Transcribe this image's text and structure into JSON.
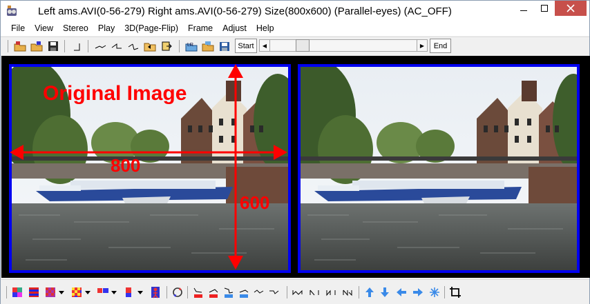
{
  "window": {
    "title": "Left ams.AVI(0-56-279) Right ams.AVI(0-56-279) Size(800x600)  (Parallel-eyes) (AC_OFF)",
    "controls": {
      "minimize": "–",
      "maximize": "☐",
      "close": "✕"
    }
  },
  "menu": {
    "items": [
      "File",
      "View",
      "Stereo",
      "Play",
      "3D(Page-Flip)",
      "Frame",
      "Adjust",
      "Help"
    ]
  },
  "toolbar": {
    "start_label": "Start",
    "end_label": "End",
    "left_arrow": "◀",
    "right_arrow": "▶"
  },
  "annotations": {
    "caption": "Original Image",
    "width_label": "800",
    "height_label": "600"
  },
  "colors": {
    "frame_border": "#0000f0",
    "annotation": "#ff0000",
    "viewer_bg": "#000000",
    "close_button": "#c7504b"
  },
  "icons": {
    "toolbar_top": [
      "open-left-icon",
      "open-right-icon",
      "save-icon",
      "swap-icon",
      "line-1-icon",
      "line-2-icon",
      "line-3-icon",
      "open-folder-icon",
      "export-icon",
      "load-l-icon",
      "load-r-icon",
      "save-pair-icon"
    ],
    "toolbar_bottom": [
      "color-anaglyph-icon",
      "interlace-icon",
      "checker-icon",
      "mosaic-icon",
      "side-by-side-icon",
      "single-view-icon",
      "person-icon",
      "rotate-icon",
      "align-1-icon",
      "align-2-icon",
      "align-3-icon",
      "align-4-icon",
      "align-5-icon",
      "align-6-icon",
      "align-7-icon",
      "align-8-icon",
      "align-9-icon",
      "align-10-icon",
      "up-arrow-icon",
      "down-arrow-icon",
      "left-arrow-icon",
      "right-arrow-icon",
      "snowflake-icon",
      "crop-icon"
    ]
  }
}
